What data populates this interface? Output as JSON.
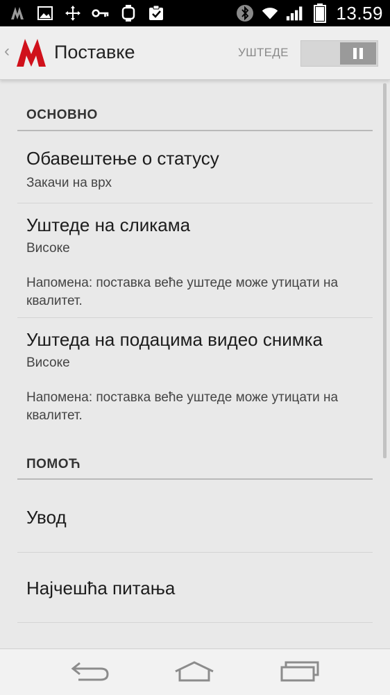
{
  "status_bar": {
    "time": "13.59",
    "left_icons": [
      "opera-max-icon",
      "image-icon",
      "move-icon",
      "key-icon",
      "watch-icon",
      "clipboard-check-icon"
    ],
    "right_icons": [
      "bluetooth-icon",
      "wifi-icon",
      "signal-icon",
      "battery-icon"
    ]
  },
  "action_bar": {
    "title": "Поставке",
    "savings_label": "УШТЕДЕ",
    "toggle_state": "on",
    "accent_color": "#d0111b"
  },
  "sections": [
    {
      "header": "ОСНОВНО",
      "items": [
        {
          "title": "Обавештење о статусу",
          "summary": "Закачи на врх"
        },
        {
          "title": "Уштеде на сликама",
          "summary": "Високе",
          "note": "Напомена: поставка веће уштеде може утицати на квалитет."
        },
        {
          "title": "Уштеда на подацима видео снимка",
          "summary": "Високе",
          "note": "Напомена: поставка веће уштеде може утицати на квалитет."
        }
      ]
    },
    {
      "header": "ПОМОЋ",
      "items": [
        {
          "title": "Увод"
        },
        {
          "title": "Најчешћа питања"
        }
      ]
    }
  ],
  "nav_bar": {
    "buttons": [
      "back-icon",
      "home-icon",
      "recents-icon"
    ]
  }
}
